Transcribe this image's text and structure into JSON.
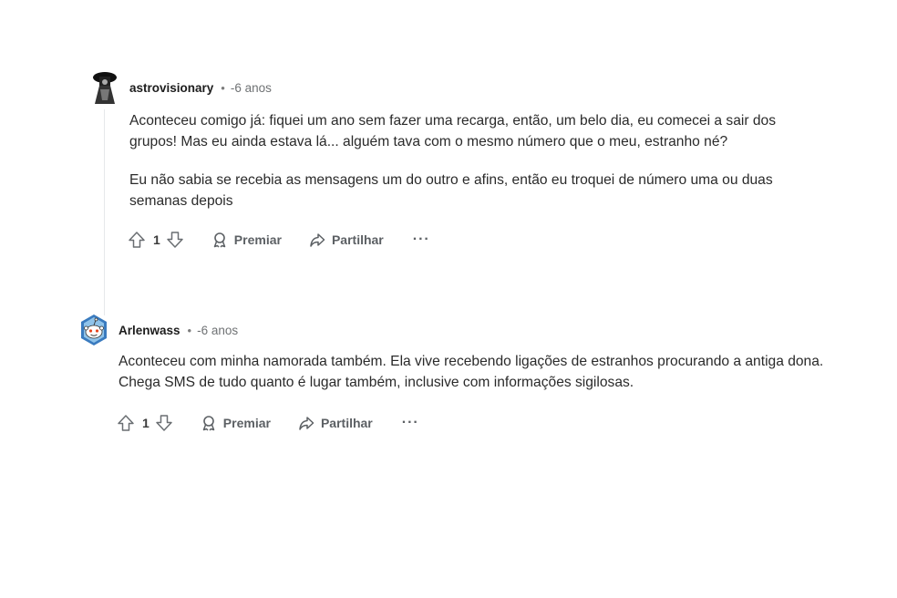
{
  "comments": [
    {
      "username": "astrovisionary",
      "separator": "•",
      "time": "-6 anos",
      "paragraphs": [
        "Aconteceu comigo já: fiquei um ano sem fazer uma recarga, então, um belo dia, eu comecei a sair dos grupos! Mas eu ainda estava lá... alguém tava com o mesmo número que o meu, estranho né?",
        "Eu não sabia se recebia as mensagens um do outro e afins, então eu troquei de número uma ou duas semanas depois"
      ],
      "votes": "1",
      "award_label": "Premiar",
      "share_label": "Partilhar",
      "more_label": "···"
    },
    {
      "username": "Arlenwass",
      "separator": "•",
      "time": "-6 anos",
      "paragraphs": [
        "Aconteceu com minha namorada também. Ela vive recebendo ligações de estranhos procurando a antiga dona. Chega SMS de tudo quanto é lugar também, inclusive com informações sigilosas."
      ],
      "votes": "1",
      "award_label": "Premiar",
      "share_label": "Partilhar",
      "more_label": "···"
    }
  ],
  "colors": {
    "text": "#1c1c1c",
    "muted": "#6f7274",
    "action": "#5c6064",
    "thread_line": "#e6e8ea"
  }
}
